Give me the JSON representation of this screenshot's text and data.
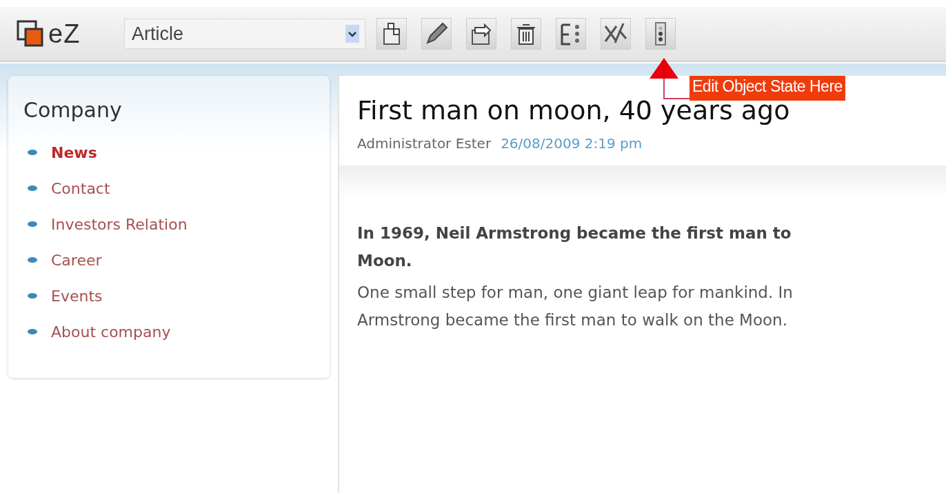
{
  "toolbar": {
    "logo": "eZ",
    "class_select": {
      "value": "Article"
    }
  },
  "annotation": {
    "text": "Edit Object State Here"
  },
  "sidebar": {
    "title": "Company",
    "items": [
      {
        "label": "News",
        "selected": true
      },
      {
        "label": "Contact",
        "selected": false
      },
      {
        "label": "Investors Relation",
        "selected": false
      },
      {
        "label": "Career",
        "selected": false
      },
      {
        "label": "Events",
        "selected": false
      },
      {
        "label": "About company",
        "selected": false
      }
    ]
  },
  "article": {
    "title": "First man on moon, 40 years ago",
    "author": "Administrator Ester",
    "date": "26/08/2009 2:19 pm",
    "intro_lines": [
      "In 1969, Neil Armstrong became the first man to",
      "Moon."
    ],
    "body_lines": [
      "One small step for man, one giant leap for mankind. In",
      "Armstrong became the first man to walk on the Moon."
    ]
  }
}
